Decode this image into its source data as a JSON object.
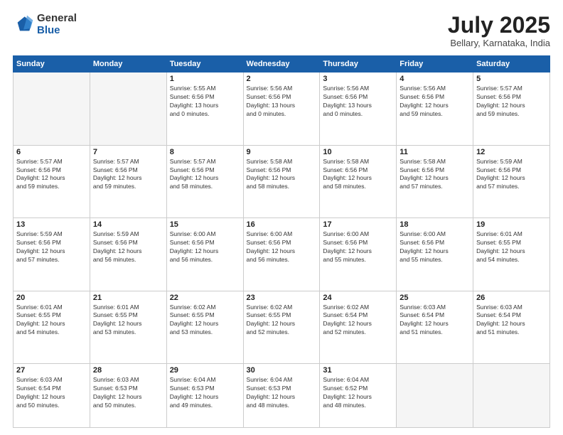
{
  "header": {
    "logo_general": "General",
    "logo_blue": "Blue",
    "month_year": "July 2025",
    "location": "Bellary, Karnataka, India"
  },
  "days_of_week": [
    "Sunday",
    "Monday",
    "Tuesday",
    "Wednesday",
    "Thursday",
    "Friday",
    "Saturday"
  ],
  "weeks": [
    [
      {
        "day": "",
        "info": ""
      },
      {
        "day": "",
        "info": ""
      },
      {
        "day": "1",
        "info": "Sunrise: 5:55 AM\nSunset: 6:56 PM\nDaylight: 13 hours\nand 0 minutes."
      },
      {
        "day": "2",
        "info": "Sunrise: 5:56 AM\nSunset: 6:56 PM\nDaylight: 13 hours\nand 0 minutes."
      },
      {
        "day": "3",
        "info": "Sunrise: 5:56 AM\nSunset: 6:56 PM\nDaylight: 13 hours\nand 0 minutes."
      },
      {
        "day": "4",
        "info": "Sunrise: 5:56 AM\nSunset: 6:56 PM\nDaylight: 12 hours\nand 59 minutes."
      },
      {
        "day": "5",
        "info": "Sunrise: 5:57 AM\nSunset: 6:56 PM\nDaylight: 12 hours\nand 59 minutes."
      }
    ],
    [
      {
        "day": "6",
        "info": "Sunrise: 5:57 AM\nSunset: 6:56 PM\nDaylight: 12 hours\nand 59 minutes."
      },
      {
        "day": "7",
        "info": "Sunrise: 5:57 AM\nSunset: 6:56 PM\nDaylight: 12 hours\nand 59 minutes."
      },
      {
        "day": "8",
        "info": "Sunrise: 5:57 AM\nSunset: 6:56 PM\nDaylight: 12 hours\nand 58 minutes."
      },
      {
        "day": "9",
        "info": "Sunrise: 5:58 AM\nSunset: 6:56 PM\nDaylight: 12 hours\nand 58 minutes."
      },
      {
        "day": "10",
        "info": "Sunrise: 5:58 AM\nSunset: 6:56 PM\nDaylight: 12 hours\nand 58 minutes."
      },
      {
        "day": "11",
        "info": "Sunrise: 5:58 AM\nSunset: 6:56 PM\nDaylight: 12 hours\nand 57 minutes."
      },
      {
        "day": "12",
        "info": "Sunrise: 5:59 AM\nSunset: 6:56 PM\nDaylight: 12 hours\nand 57 minutes."
      }
    ],
    [
      {
        "day": "13",
        "info": "Sunrise: 5:59 AM\nSunset: 6:56 PM\nDaylight: 12 hours\nand 57 minutes."
      },
      {
        "day": "14",
        "info": "Sunrise: 5:59 AM\nSunset: 6:56 PM\nDaylight: 12 hours\nand 56 minutes."
      },
      {
        "day": "15",
        "info": "Sunrise: 6:00 AM\nSunset: 6:56 PM\nDaylight: 12 hours\nand 56 minutes."
      },
      {
        "day": "16",
        "info": "Sunrise: 6:00 AM\nSunset: 6:56 PM\nDaylight: 12 hours\nand 56 minutes."
      },
      {
        "day": "17",
        "info": "Sunrise: 6:00 AM\nSunset: 6:56 PM\nDaylight: 12 hours\nand 55 minutes."
      },
      {
        "day": "18",
        "info": "Sunrise: 6:00 AM\nSunset: 6:56 PM\nDaylight: 12 hours\nand 55 minutes."
      },
      {
        "day": "19",
        "info": "Sunrise: 6:01 AM\nSunset: 6:55 PM\nDaylight: 12 hours\nand 54 minutes."
      }
    ],
    [
      {
        "day": "20",
        "info": "Sunrise: 6:01 AM\nSunset: 6:55 PM\nDaylight: 12 hours\nand 54 minutes."
      },
      {
        "day": "21",
        "info": "Sunrise: 6:01 AM\nSunset: 6:55 PM\nDaylight: 12 hours\nand 53 minutes."
      },
      {
        "day": "22",
        "info": "Sunrise: 6:02 AM\nSunset: 6:55 PM\nDaylight: 12 hours\nand 53 minutes."
      },
      {
        "day": "23",
        "info": "Sunrise: 6:02 AM\nSunset: 6:55 PM\nDaylight: 12 hours\nand 52 minutes."
      },
      {
        "day": "24",
        "info": "Sunrise: 6:02 AM\nSunset: 6:54 PM\nDaylight: 12 hours\nand 52 minutes."
      },
      {
        "day": "25",
        "info": "Sunrise: 6:03 AM\nSunset: 6:54 PM\nDaylight: 12 hours\nand 51 minutes."
      },
      {
        "day": "26",
        "info": "Sunrise: 6:03 AM\nSunset: 6:54 PM\nDaylight: 12 hours\nand 51 minutes."
      }
    ],
    [
      {
        "day": "27",
        "info": "Sunrise: 6:03 AM\nSunset: 6:54 PM\nDaylight: 12 hours\nand 50 minutes."
      },
      {
        "day": "28",
        "info": "Sunrise: 6:03 AM\nSunset: 6:53 PM\nDaylight: 12 hours\nand 50 minutes."
      },
      {
        "day": "29",
        "info": "Sunrise: 6:04 AM\nSunset: 6:53 PM\nDaylight: 12 hours\nand 49 minutes."
      },
      {
        "day": "30",
        "info": "Sunrise: 6:04 AM\nSunset: 6:53 PM\nDaylight: 12 hours\nand 48 minutes."
      },
      {
        "day": "31",
        "info": "Sunrise: 6:04 AM\nSunset: 6:52 PM\nDaylight: 12 hours\nand 48 minutes."
      },
      {
        "day": "",
        "info": ""
      },
      {
        "day": "",
        "info": ""
      }
    ]
  ]
}
